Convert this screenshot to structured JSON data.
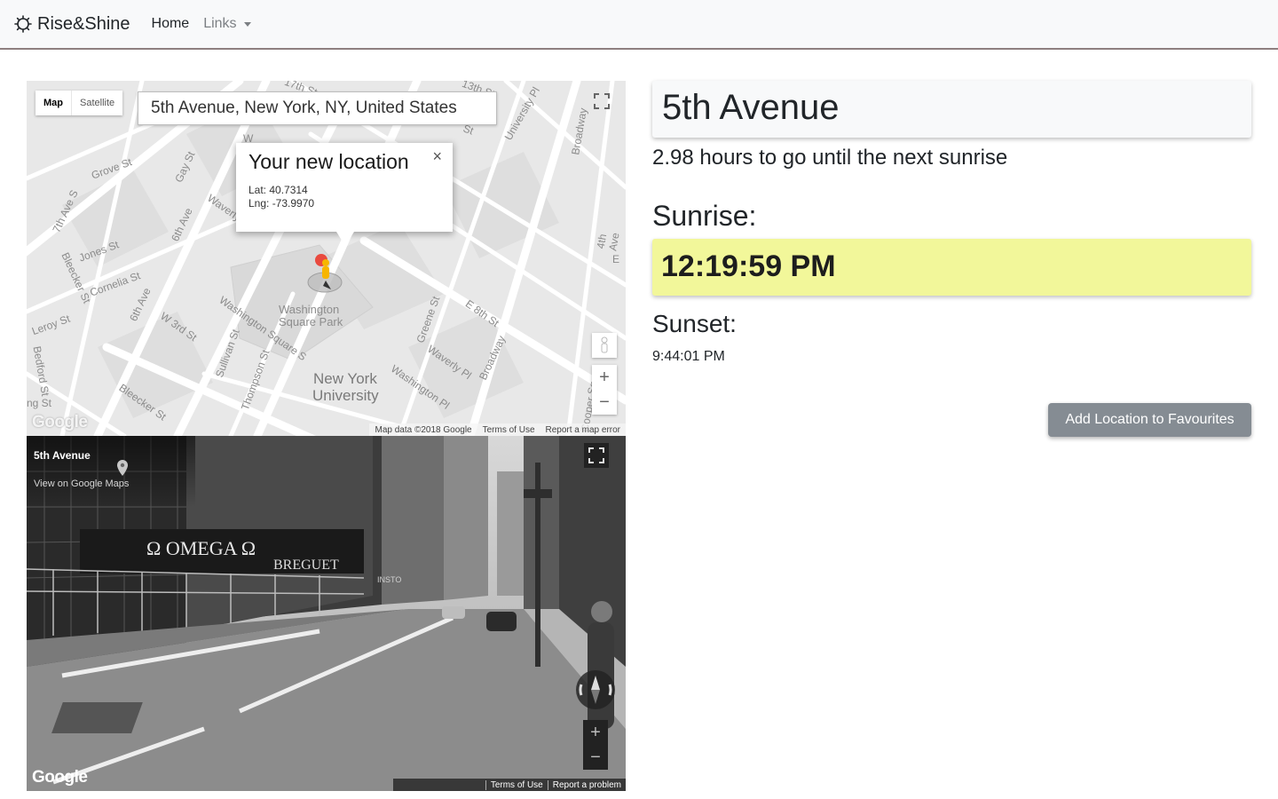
{
  "navbar": {
    "brand": "Rise&Shine",
    "home": "Home",
    "links": "Links",
    "brand_icon": "sun-outline-icon",
    "border_color": "#8e7f7f"
  },
  "map": {
    "type_map": "Map",
    "type_satellite": "Satellite",
    "search_value": "5th Avenue, New York, NY, United States",
    "popup": {
      "title": "Your new location",
      "lat": "Lat: 40.7314",
      "lng": "Lng: -73.9970",
      "close": "×"
    },
    "zoom_in": "+",
    "zoom_out": "−",
    "logo": "Google",
    "attribution": {
      "data": "Map data ©2018 Google",
      "terms": "Terms of Use",
      "report": "Report a map error"
    },
    "labels": {
      "wsp1": "Washington",
      "wsp2": "Square Park",
      "nyu1": "New York",
      "nyu2": "University",
      "grove": "Grove St",
      "gay": "Gay St",
      "seventh": "7th Ave S",
      "jones": "Jones St",
      "cornelia": "Cornelia St",
      "bleecker1": "Bleecker St",
      "leroy": "Leroy St",
      "sixth1": "6th Ave",
      "sixth2": "6th Ave",
      "w3rd": "W 3rd St",
      "wsq": "Washington Square S",
      "sullivan": "Sullivan St",
      "thompson": "Thompson St",
      "bleecker2": "Bleecker St",
      "e8th": "E 8th St",
      "greene": "Greene St",
      "waverly1": "Waverly Pl",
      "waverly2": "Waverly Pl",
      "washpl": "Washington Pl",
      "broadway1": "Broadway",
      "broadway2": "Broadway",
      "univ": "University Pl",
      "fourth": "4th Ave",
      "bedford": "Bedford St",
      "cooper": "Cooper Sq",
      "thirteenth": "13th St",
      "seventeenth": "17th St",
      "w": "W",
      "e": "E",
      "st": "St",
      "ng": "ng St"
    }
  },
  "streetview": {
    "title": "5th Avenue",
    "link": "View on Google Maps",
    "logo": "Google",
    "terms": "Terms of Use",
    "report": "Report a problem",
    "zoom_in": "+",
    "zoom_out": "−",
    "sign_omega": "Ω OMEGA Ω",
    "sign_breguet": "BREGUET",
    "sign_store": "INSTO"
  },
  "location": {
    "name": "5th Avenue",
    "hours_text": "2.98 hours to go until the next sunrise",
    "sunrise_label": "Sunrise:",
    "sunrise_time": "12:19:59 PM",
    "sunset_label": "Sunset:",
    "sunset_time": "9:44:01 PM",
    "fav_button": "Add Location to Favourites",
    "sunrise_color": "#f2f79a"
  }
}
